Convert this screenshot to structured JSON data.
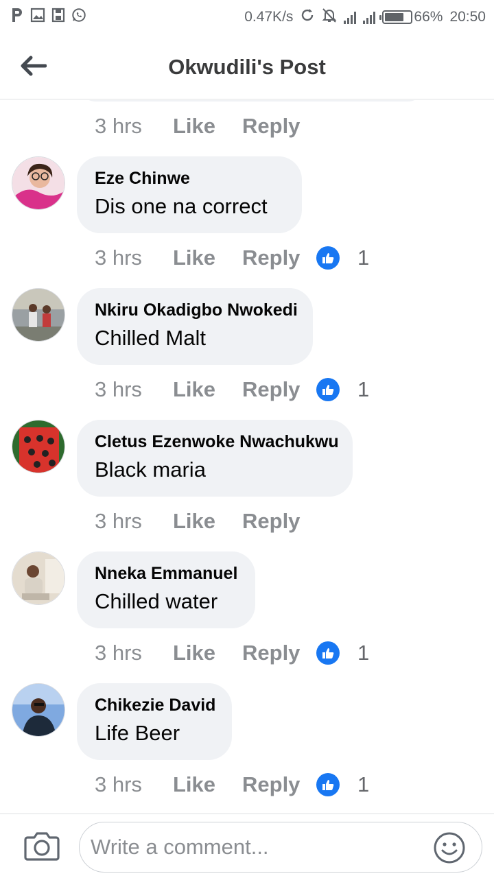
{
  "status_bar": {
    "left_icons": [
      "p-app-icon",
      "image-icon",
      "save-icon",
      "whatsapp-icon"
    ],
    "network_speed": "0.47K/s",
    "battery": "66%",
    "time": "20:50"
  },
  "header": {
    "title": "Okwudili's Post"
  },
  "top_meta": {
    "time": "3 hrs",
    "like": "Like",
    "reply": "Reply"
  },
  "comments": [
    {
      "author": "Eze Chinwe",
      "text": "Dis one na correct",
      "time": "3 hrs",
      "like": "Like",
      "reply": "Reply",
      "reactions": "1"
    },
    {
      "author": "Nkiru Okadigbo Nwokedi",
      "text": "Chilled Malt",
      "time": "3 hrs",
      "like": "Like",
      "reply": "Reply",
      "reactions": "1"
    },
    {
      "author": "Cletus Ezenwoke Nwachukwu",
      "text": "Black maria",
      "time": "3 hrs",
      "like": "Like",
      "reply": "Reply",
      "reactions": ""
    },
    {
      "author": "Nneka Emmanuel",
      "text": "Chilled water",
      "time": "3 hrs",
      "like": "Like",
      "reply": "Reply",
      "reactions": "1"
    },
    {
      "author": "Chikezie David",
      "text": "Life Beer",
      "time": "3 hrs",
      "like": "Like",
      "reply": "Reply",
      "reactions": "1"
    }
  ],
  "composer": {
    "placeholder": "Write a comment..."
  },
  "colors": {
    "accent": "#1877f2",
    "bubble": "#f0f2f5",
    "meta": "#8a8d91"
  }
}
